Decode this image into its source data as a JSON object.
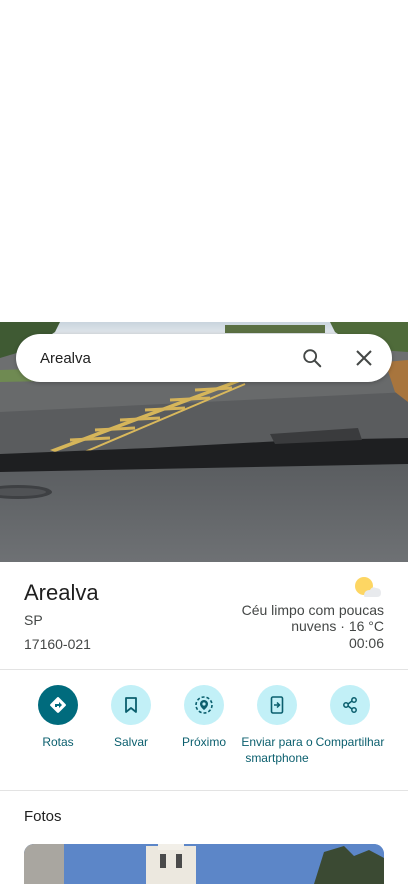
{
  "search": {
    "query": "Arealva"
  },
  "place": {
    "name": "Arealva",
    "state": "SP",
    "postal_code": "17160-021"
  },
  "weather": {
    "description": "Céu limpo com poucas nuvens · 16 °C",
    "time": "00:06",
    "icon": "partly-cloudy-icon"
  },
  "actions": [
    {
      "label": "Rotas",
      "icon": "directions-icon"
    },
    {
      "label": "Salvar",
      "icon": "bookmark-icon"
    },
    {
      "label": "Próximo",
      "icon": "nearby-icon"
    },
    {
      "label": "Enviar para o smartphone",
      "icon": "send-to-phone-icon"
    },
    {
      "label": "Compartilhar",
      "icon": "share-icon"
    }
  ],
  "photos": {
    "title": "Fotos"
  },
  "colors": {
    "accent": "#006b7d",
    "action_bg": "#c2f0f7",
    "action_text": "#0b5f6e"
  }
}
